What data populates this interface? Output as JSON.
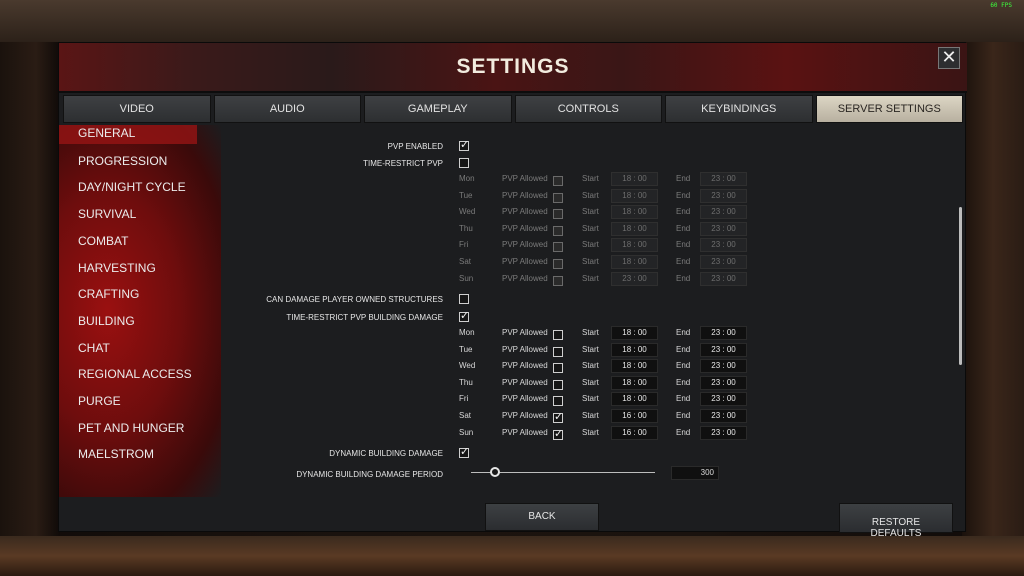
{
  "hud": {
    "fps": "60 FPS"
  },
  "window": {
    "title": "SETTINGS",
    "close": "✕"
  },
  "tabs": [
    "VIDEO",
    "AUDIO",
    "GAMEPLAY",
    "CONTROLS",
    "KEYBINDINGS",
    "SERVER SETTINGS"
  ],
  "active_tab": "SERVER SETTINGS",
  "sidebar": {
    "active": "GENERAL",
    "items": [
      "GENERAL",
      "PROGRESSION",
      "DAY/NIGHT CYCLE",
      "SURVIVAL",
      "COMBAT",
      "HARVESTING",
      "CRAFTING",
      "BUILDING",
      "CHAT",
      "REGIONAL ACCESS",
      "PURGE",
      "PET AND HUNGER",
      "MAELSTROM"
    ]
  },
  "settings": {
    "pvp_enabled": {
      "label": "PVP ENABLED",
      "checked": true
    },
    "time_restrict_pvp": {
      "label": "TIME-RESTRICT PVP",
      "checked": false
    },
    "pvp_schedule": {
      "allowed_label": "PVP Allowed",
      "start_label": "Start",
      "end_label": "End",
      "days": [
        {
          "day": "Mon",
          "allowed": false,
          "start": "18 : 00",
          "end": "23 : 00"
        },
        {
          "day": "Tue",
          "allowed": false,
          "start": "18 : 00",
          "end": "23 : 00"
        },
        {
          "day": "Wed",
          "allowed": false,
          "start": "18 : 00",
          "end": "23 : 00"
        },
        {
          "day": "Thu",
          "allowed": false,
          "start": "18 : 00",
          "end": "23 : 00"
        },
        {
          "day": "Fri",
          "allowed": false,
          "start": "18 : 00",
          "end": "23 : 00"
        },
        {
          "day": "Sat",
          "allowed": false,
          "start": "18 : 00",
          "end": "23 : 00"
        },
        {
          "day": "Sun",
          "allowed": false,
          "start": "23 : 00",
          "end": "23 : 00"
        }
      ]
    },
    "can_damage_structures": {
      "label": "CAN DAMAGE PLAYER OWNED STRUCTURES",
      "checked": false
    },
    "time_restrict_building_damage": {
      "label": "TIME-RESTRICT PVP BUILDING DAMAGE",
      "checked": true
    },
    "building_schedule": {
      "allowed_label": "PVP Allowed",
      "start_label": "Start",
      "end_label": "End",
      "days": [
        {
          "day": "Mon",
          "allowed": false,
          "start": "18 : 00",
          "end": "23 : 00"
        },
        {
          "day": "Tue",
          "allowed": false,
          "start": "18 : 00",
          "end": "23 : 00"
        },
        {
          "day": "Wed",
          "allowed": false,
          "start": "18 : 00",
          "end": "23 : 00"
        },
        {
          "day": "Thu",
          "allowed": false,
          "start": "18 : 00",
          "end": "23 : 00"
        },
        {
          "day": "Fri",
          "allowed": false,
          "start": "18 : 00",
          "end": "23 : 00"
        },
        {
          "day": "Sat",
          "allowed": true,
          "start": "16 : 00",
          "end": "23 : 00"
        },
        {
          "day": "Sun",
          "allowed": true,
          "start": "16 : 00",
          "end": "23 : 00"
        }
      ]
    },
    "dynamic_building_damage": {
      "label": "DYNAMIC BUILDING DAMAGE",
      "checked": true
    },
    "dynamic_building_damage_period": {
      "label": "DYNAMIC BUILDING DAMAGE PERIOD",
      "value": "300",
      "slider_fraction": 0.13
    }
  },
  "footer": {
    "back": "BACK",
    "restore": "RESTORE\nDEFAULTS"
  }
}
